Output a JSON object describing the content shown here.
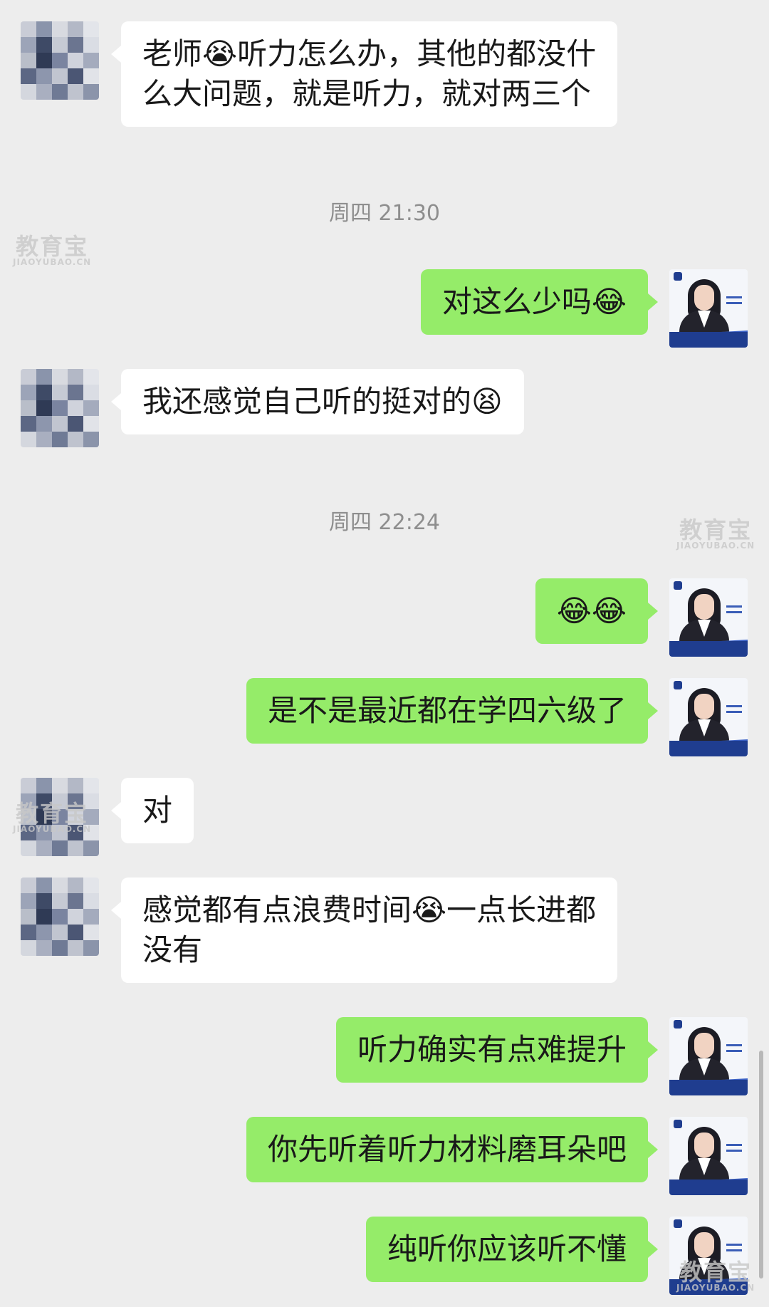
{
  "conversation": {
    "messages": [
      {
        "side": "in",
        "lines": [
          "老师😭听力怎么办，其他的都没什",
          "么大问题，就是听力，就对两三个"
        ]
      },
      {
        "side": "out",
        "text": "对这么少吗😂"
      },
      {
        "side": "in",
        "text": "我还感觉自己听的挺对的😫"
      },
      {
        "side": "out",
        "text": "😂😂"
      },
      {
        "side": "out",
        "text": "是不是最近都在学四六级了"
      },
      {
        "side": "in",
        "text": "对"
      },
      {
        "side": "in",
        "lines": [
          "感觉都有点浪费时间😭一点长进都",
          "没有"
        ]
      },
      {
        "side": "out",
        "text": "听力确实有点难提升"
      },
      {
        "side": "out",
        "text": "你先听着听力材料磨耳朵吧"
      },
      {
        "side": "out",
        "text": "纯听你应该听不懂"
      }
    ],
    "timestamps": [
      "周四 21:30",
      "周四 22:24"
    ]
  },
  "watermark": {
    "cn": "教育宝",
    "en": "JIAOYUBAO.CN"
  },
  "colors": {
    "background": "#ededed",
    "incoming": "#ffffff",
    "outgoing": "#95ec69",
    "timestamp": "#8e8e8e"
  }
}
